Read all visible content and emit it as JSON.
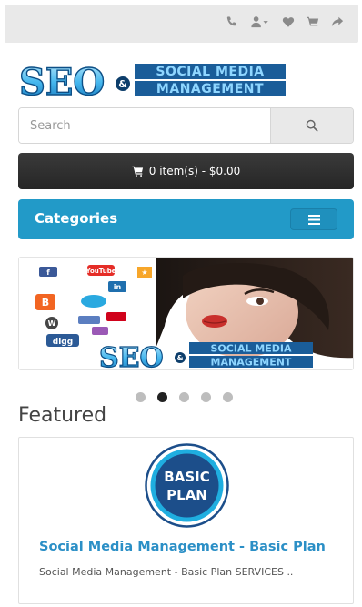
{
  "search": {
    "placeholder": "Search"
  },
  "cart": {
    "label": "0 item(s) - $0.00"
  },
  "categories": {
    "label": "Categories"
  },
  "logo": {
    "text_left": "SEO",
    "amp": "&",
    "text_line1": "SOCIAL MEDIA",
    "text_line2": "MANAGEMENT"
  },
  "banner": {
    "logo_left": "SEO",
    "logo_amp": "&",
    "logo_line1": "SOCIAL MEDIA",
    "logo_line2": "MANAGEMENT",
    "social_labels": [
      "YouTube",
      "in",
      "digg"
    ]
  },
  "carousel": {
    "count": 5,
    "active_index": 1
  },
  "featured": {
    "heading": "Featured",
    "product": {
      "badge_line1": "BASIC",
      "badge_line2": "PLAN",
      "title": "Social Media Management - Basic Plan",
      "description": "Social Media Management - Basic Plan  SERVICES  .."
    }
  },
  "colors": {
    "accent_blue": "#229ac8",
    "link_blue": "#2b8fc6",
    "cart_dark": "#2e2e2e",
    "badge_navy": "#1c4e8a",
    "badge_ring": "#1faee0"
  }
}
